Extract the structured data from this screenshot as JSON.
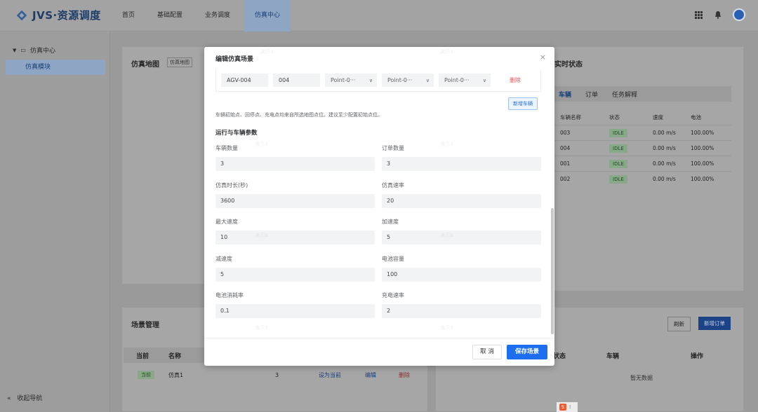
{
  "app": {
    "title": "JVS·资源调度"
  },
  "nav": [
    {
      "label": "首页"
    },
    {
      "label": "基础配置"
    },
    {
      "label": "业务调度"
    },
    {
      "label": "仿真中心"
    }
  ],
  "sidebar": {
    "group": "仿真中心",
    "item": "仿真模块",
    "collapse": "收起导航"
  },
  "map_panel": {
    "title": "仿真地图",
    "tag": "仿真地图"
  },
  "realtime": {
    "title": "实时状态",
    "tabs": [
      "车辆",
      "订单",
      "任务解释"
    ],
    "headers": [
      "车辆名称",
      "状态",
      "速度",
      "电池"
    ],
    "rows": [
      [
        "003",
        "IDLE",
        "0.00 m/s",
        "100.00%"
      ],
      [
        "004",
        "IDLE",
        "0.00 m/s",
        "100.00%"
      ],
      [
        "001",
        "IDLE",
        "0.00 m/s",
        "100.00%"
      ],
      [
        "002",
        "IDLE",
        "0.00 m/s",
        "100.00%"
      ]
    ]
  },
  "scene_panel": {
    "title": "场景管理",
    "headers": [
      "当前",
      "名称"
    ],
    "row": {
      "current": "当前",
      "name": "仿真1",
      "count": "3",
      "set_current": "设为当前",
      "edit": "编辑",
      "delete": "删除"
    }
  },
  "order_panel": {
    "refresh": "刷新",
    "new_order": "新增订单",
    "headers": [
      "状态",
      "车辆",
      "操作"
    ],
    "empty": "暂无数据"
  },
  "modal": {
    "title": "编辑仿真场景",
    "close": "×",
    "vehicle_row": {
      "name": "AGV-004",
      "code": "004",
      "start": "Point-0···",
      "park": "Point-0···",
      "charge": "Point-0···",
      "delete": "删除"
    },
    "add_vehicle": "新增车辆",
    "hint": "车辆初始点、回停点、充电点均来自所选地图点位。建议至少配置初始点位。",
    "section": "运行与车辆参数",
    "fields": {
      "vehicle_count": {
        "label": "车辆数量",
        "value": "3"
      },
      "order_count": {
        "label": "订单数量",
        "value": "3"
      },
      "duration": {
        "label": "仿真时长(秒)",
        "value": "3600"
      },
      "rate": {
        "label": "仿真速率",
        "value": "20"
      },
      "max_speed": {
        "label": "最大速度",
        "value": "10"
      },
      "accel": {
        "label": "加速度",
        "value": "5"
      },
      "decel": {
        "label": "减速度",
        "value": "5"
      },
      "battery_cap": {
        "label": "电池容量",
        "value": "100"
      },
      "drain_rate": {
        "label": "电池消耗率",
        "value": "0.1"
      },
      "charge_rate": {
        "label": "充电速率",
        "value": "2"
      }
    },
    "cancel": "取 消",
    "save": "保存场景"
  },
  "watermark": "演示3"
}
